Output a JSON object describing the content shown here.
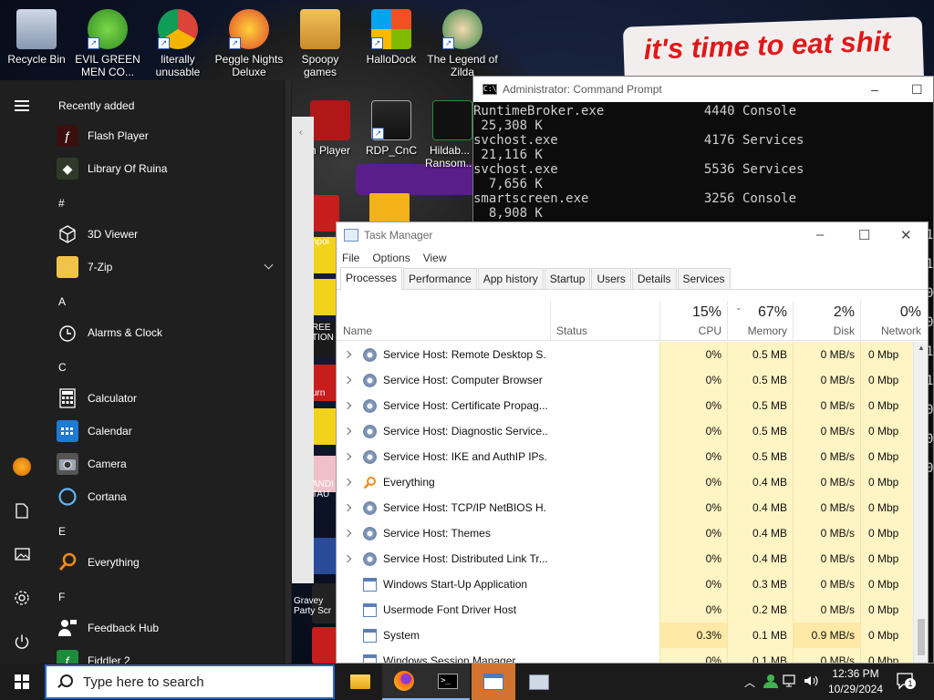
{
  "desktop": {
    "banner_text": "it's time to eat shit",
    "icons": [
      {
        "label": "Recycle Bin"
      },
      {
        "label": "EVIL GREEN MEN CO..."
      },
      {
        "label": "literally unusable"
      },
      {
        "label": "Peggle Nights Deluxe"
      },
      {
        "label": "Spoopy games"
      },
      {
        "label": "HalloDock"
      },
      {
        "label": "The Legend of Zilda"
      },
      {
        "label": "RDP_CnC"
      },
      {
        "label": "Hildab... Ransom..."
      },
      {
        "label": "n Player"
      }
    ],
    "strip_labels": [
      "hpoi",
      "REE TION",
      "urn",
      "ANDI TAU",
      "Gravey Party Scr"
    ]
  },
  "start_menu": {
    "recently_added_header": "Recently added",
    "groups": [
      {
        "header": "",
        "apps": [
          "Flash Player",
          "Library Of Ruina"
        ]
      },
      {
        "header": "#",
        "apps": [
          "3D Viewer",
          "7-Zip"
        ]
      },
      {
        "header": "A",
        "apps": [
          "Alarms & Clock"
        ]
      },
      {
        "header": "C",
        "apps": [
          "Calculator",
          "Calendar",
          "Camera",
          "Cortana"
        ]
      },
      {
        "header": "E",
        "apps": [
          "Everything"
        ]
      },
      {
        "header": "F",
        "apps": [
          "Feedback Hub",
          "Fiddler 2"
        ]
      }
    ]
  },
  "cmd": {
    "title": "Administrator: Command Prompt",
    "lines": [
      "RuntimeBroker.exe             4440 Console                    1",
      " 25,308 K",
      "svchost.exe                   4176 Services                   0",
      " 21,116 K",
      "svchost.exe                   5536 Services                   0",
      "  7,656 K",
      "smartscreen.exe               3256 Console                    1",
      "  8,908 K"
    ],
    "right_digits": [
      "1",
      "1",
      "0",
      "0",
      "1",
      "1",
      "0",
      "0",
      "0"
    ]
  },
  "task_manager": {
    "title": "Task Manager",
    "menu": [
      "File",
      "Options",
      "View"
    ],
    "tabs": [
      "Processes",
      "Performance",
      "App history",
      "Startup",
      "Users",
      "Details",
      "Services"
    ],
    "active_tab": "Processes",
    "columns": {
      "name": "Name",
      "status": "Status",
      "cpu": {
        "percent": "15%",
        "label": "CPU"
      },
      "memory": {
        "percent": "67%",
        "label": "Memory"
      },
      "disk": {
        "percent": "2%",
        "label": "Disk"
      },
      "network": {
        "percent": "0%",
        "label": "Network"
      }
    },
    "rows": [
      {
        "name": "Service Host: Remote Desktop S...",
        "cpu": "0%",
        "memory": "0.5 MB",
        "disk": "0 MB/s",
        "network": "0 Mbp",
        "icon": "gear-icon",
        "expandable": true
      },
      {
        "name": "Service Host: Computer Browser",
        "cpu": "0%",
        "memory": "0.5 MB",
        "disk": "0 MB/s",
        "network": "0 Mbp",
        "icon": "gear-icon",
        "expandable": true
      },
      {
        "name": "Service Host: Certificate Propag...",
        "cpu": "0%",
        "memory": "0.5 MB",
        "disk": "0 MB/s",
        "network": "0 Mbp",
        "icon": "gear-icon",
        "expandable": true
      },
      {
        "name": "Service Host: Diagnostic Service...",
        "cpu": "0%",
        "memory": "0.5 MB",
        "disk": "0 MB/s",
        "network": "0 Mbp",
        "icon": "gear-icon",
        "expandable": true
      },
      {
        "name": "Service Host: IKE and AuthIP IPs...",
        "cpu": "0%",
        "memory": "0.5 MB",
        "disk": "0 MB/s",
        "network": "0 Mbp",
        "icon": "gear-icon",
        "expandable": true
      },
      {
        "name": "Everything",
        "cpu": "0%",
        "memory": "0.4 MB",
        "disk": "0 MB/s",
        "network": "0 Mbp",
        "icon": "magnifier-icon",
        "expandable": true
      },
      {
        "name": "Service Host: TCP/IP NetBIOS H...",
        "cpu": "0%",
        "memory": "0.4 MB",
        "disk": "0 MB/s",
        "network": "0 Mbp",
        "icon": "gear-icon",
        "expandable": true
      },
      {
        "name": "Service Host: Themes",
        "cpu": "0%",
        "memory": "0.4 MB",
        "disk": "0 MB/s",
        "network": "0 Mbp",
        "icon": "gear-icon",
        "expandable": true
      },
      {
        "name": "Service Host: Distributed Link Tr...",
        "cpu": "0%",
        "memory": "0.4 MB",
        "disk": "0 MB/s",
        "network": "0 Mbp",
        "icon": "gear-icon",
        "expandable": true
      },
      {
        "name": "Windows Start-Up Application",
        "cpu": "0%",
        "memory": "0.3 MB",
        "disk": "0 MB/s",
        "network": "0 Mbp",
        "icon": "window-icon",
        "expandable": false
      },
      {
        "name": "Usermode Font Driver Host",
        "cpu": "0%",
        "memory": "0.2 MB",
        "disk": "0 MB/s",
        "network": "0 Mbp",
        "icon": "window-icon",
        "expandable": false
      },
      {
        "name": "System",
        "cpu": "0.3%",
        "memory": "0.1 MB",
        "disk": "0.9 MB/s",
        "network": "0 Mbp",
        "icon": "window-icon",
        "expandable": false
      },
      {
        "name": "Windows Session Manager",
        "cpu": "0%",
        "memory": "0.1 MB",
        "disk": "0 MB/s",
        "network": "0 Mbp",
        "icon": "window-icon",
        "expandable": false
      }
    ]
  },
  "taskbar": {
    "search_placeholder": "Type here to search",
    "time": "12:36 PM",
    "date": "10/29/2024",
    "notification_count": "1"
  },
  "colors": {
    "accent": "#2a64c8",
    "tm_heat": "#fff4c4",
    "banner_red": "#e01818",
    "taskbar_selected": "#d2742f"
  }
}
